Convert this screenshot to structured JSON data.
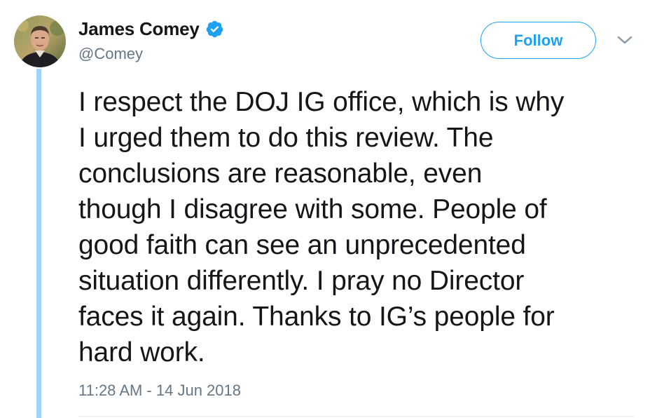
{
  "user": {
    "display_name": "James Comey",
    "handle": "@Comey",
    "verified_icon": "verified-badge-icon",
    "avatar_icon": "user-avatar"
  },
  "actions": {
    "follow_label": "Follow",
    "more_icon": "chevron-down-icon"
  },
  "tweet": {
    "lines": [
      "I respect the DOJ IG office, which is why",
      "I urged them to do this review. The",
      "conclusions are reasonable, even",
      "though I disagree with some. People of",
      "good faith can see an unprecedented",
      "situation differently. I pray no Director",
      "faces it again. Thanks to IG’s people for",
      "hard work."
    ],
    "timestamp": "11:28 AM - 14 Jun 2018"
  },
  "colors": {
    "accent": "#1da1f2",
    "thread_line": "#9fd4f6",
    "secondary_text": "#657786",
    "primary_text": "#14171a"
  }
}
